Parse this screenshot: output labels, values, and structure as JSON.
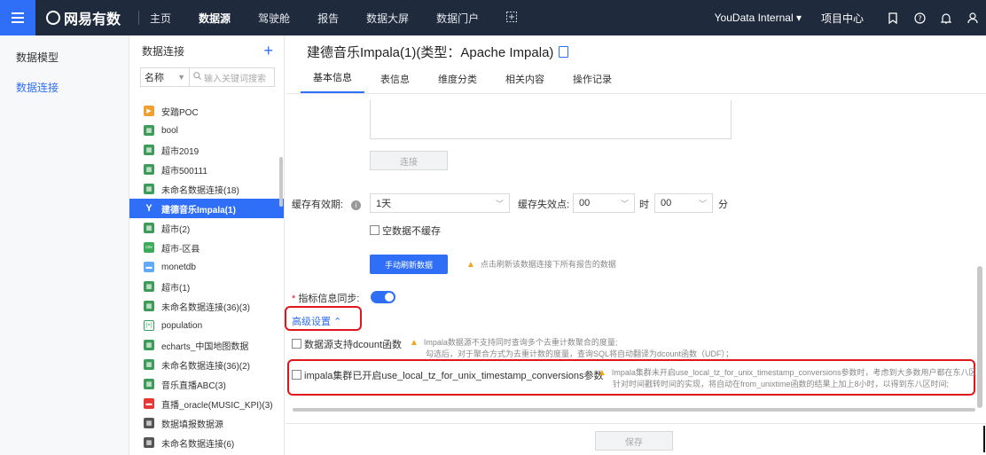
{
  "topbar": {
    "brand": "网易有数",
    "nav": [
      "主页",
      "数据源",
      "驾驶舱",
      "报告",
      "数据大屏",
      "数据门户"
    ],
    "active_nav": "数据源",
    "user": "YouData Internal",
    "project_center": "项目中心"
  },
  "leftnav": {
    "items": [
      "数据模型",
      "数据连接"
    ]
  },
  "connpanel": {
    "title": "数据连接",
    "filter_select": "名称",
    "search_placeholder": "输入关键词搜索",
    "items": [
      {
        "label": "安踏POC",
        "icon": "orange"
      },
      {
        "label": "bool",
        "icon": "green"
      },
      {
        "label": "超市2019",
        "icon": "green"
      },
      {
        "label": "超市500111",
        "icon": "green"
      },
      {
        "label": "未命名数据连接(18)",
        "icon": "green"
      },
      {
        "label": "建德音乐Impala(1)",
        "icon": "imp"
      },
      {
        "label": "超市(2)",
        "icon": "green"
      },
      {
        "label": "超市-区县",
        "icon": "csv"
      },
      {
        "label": "monetdb",
        "icon": "blue"
      },
      {
        "label": "超市(1)",
        "icon": "green"
      },
      {
        "label": "未命名数据连接(36)(3)",
        "icon": "green"
      },
      {
        "label": "population",
        "icon": "pop"
      },
      {
        "label": "echarts_中国地图数据",
        "icon": "green"
      },
      {
        "label": "未命名数据连接(36)(2)",
        "icon": "green"
      },
      {
        "label": "音乐直播ABC(3)",
        "icon": "green"
      },
      {
        "label": "直播_oracle(MUSIC_KPI)(3)",
        "icon": "red"
      },
      {
        "label": "数据填报数据源",
        "icon": "dark"
      },
      {
        "label": "未命名数据连接(6)",
        "icon": "dark"
      }
    ]
  },
  "main": {
    "title": "建德音乐Impala(1)(类型：Apache Impala)",
    "tabs": [
      "基本信息",
      "表信息",
      "维度分类",
      "相关内容",
      "操作记录"
    ],
    "connect_button": "连接",
    "cache_label": "缓存有效期",
    "cache_value": "1天",
    "cache_expire_label": "缓存失效点",
    "hour_value": "00",
    "hour_unit": "时",
    "minute_value": "00",
    "minute_unit": "分",
    "empty_no_cache": "空数据不缓存",
    "refresh_button": "手动刷新数据",
    "refresh_note": "点击刷新该数据连接下所有报告的数据",
    "sync_label": "指标信息同步",
    "advanced_label": "高级设置",
    "dcount_label": "数据源支持dcount函数",
    "dcount_note_1": "Impala数据源不支持同时查询多个去重计数聚合的度量;",
    "dcount_note_2": "勾选后，对于聚合方式为去重计数的度量，查询SQL将自动翻译为dcount函数（UDF）；",
    "tz_label": "impala集群已开启use_local_tz_for_unix_timestamp_conversions参数",
    "tz_note_1": "Impala集群未开启use_local_tz_for_unix_timestamp_conversions参数时，考虑到大多数用户都在东八区，",
    "tz_note_2": "针对时间戳转时间的实现，将自动在from_unixtime函数的结果上加上8小时，以得到东八区时间;",
    "save_button": "保存"
  },
  "colors": {
    "primary": "#2f6ef6",
    "topbar": "#1f2a3d",
    "highlight": "#e0161d",
    "warning": "#f2a51a"
  }
}
